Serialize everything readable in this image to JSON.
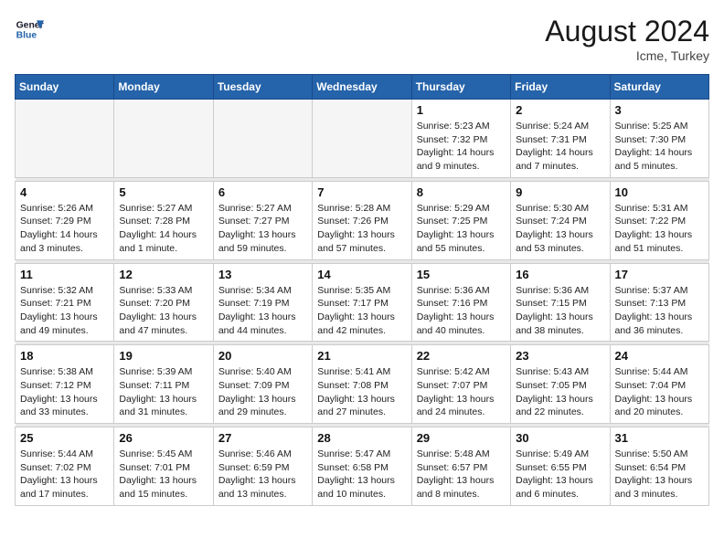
{
  "header": {
    "logo_line1": "General",
    "logo_line2": "Blue",
    "month_year": "August 2024",
    "location": "Icme, Turkey"
  },
  "days_of_week": [
    "Sunday",
    "Monday",
    "Tuesday",
    "Wednesday",
    "Thursday",
    "Friday",
    "Saturday"
  ],
  "weeks": [
    [
      {
        "day": "",
        "info": ""
      },
      {
        "day": "",
        "info": ""
      },
      {
        "day": "",
        "info": ""
      },
      {
        "day": "",
        "info": ""
      },
      {
        "day": "1",
        "info": "Sunrise: 5:23 AM\nSunset: 7:32 PM\nDaylight: 14 hours\nand 9 minutes."
      },
      {
        "day": "2",
        "info": "Sunrise: 5:24 AM\nSunset: 7:31 PM\nDaylight: 14 hours\nand 7 minutes."
      },
      {
        "day": "3",
        "info": "Sunrise: 5:25 AM\nSunset: 7:30 PM\nDaylight: 14 hours\nand 5 minutes."
      }
    ],
    [
      {
        "day": "4",
        "info": "Sunrise: 5:26 AM\nSunset: 7:29 PM\nDaylight: 14 hours\nand 3 minutes."
      },
      {
        "day": "5",
        "info": "Sunrise: 5:27 AM\nSunset: 7:28 PM\nDaylight: 14 hours\nand 1 minute."
      },
      {
        "day": "6",
        "info": "Sunrise: 5:27 AM\nSunset: 7:27 PM\nDaylight: 13 hours\nand 59 minutes."
      },
      {
        "day": "7",
        "info": "Sunrise: 5:28 AM\nSunset: 7:26 PM\nDaylight: 13 hours\nand 57 minutes."
      },
      {
        "day": "8",
        "info": "Sunrise: 5:29 AM\nSunset: 7:25 PM\nDaylight: 13 hours\nand 55 minutes."
      },
      {
        "day": "9",
        "info": "Sunrise: 5:30 AM\nSunset: 7:24 PM\nDaylight: 13 hours\nand 53 minutes."
      },
      {
        "day": "10",
        "info": "Sunrise: 5:31 AM\nSunset: 7:22 PM\nDaylight: 13 hours\nand 51 minutes."
      }
    ],
    [
      {
        "day": "11",
        "info": "Sunrise: 5:32 AM\nSunset: 7:21 PM\nDaylight: 13 hours\nand 49 minutes."
      },
      {
        "day": "12",
        "info": "Sunrise: 5:33 AM\nSunset: 7:20 PM\nDaylight: 13 hours\nand 47 minutes."
      },
      {
        "day": "13",
        "info": "Sunrise: 5:34 AM\nSunset: 7:19 PM\nDaylight: 13 hours\nand 44 minutes."
      },
      {
        "day": "14",
        "info": "Sunrise: 5:35 AM\nSunset: 7:17 PM\nDaylight: 13 hours\nand 42 minutes."
      },
      {
        "day": "15",
        "info": "Sunrise: 5:36 AM\nSunset: 7:16 PM\nDaylight: 13 hours\nand 40 minutes."
      },
      {
        "day": "16",
        "info": "Sunrise: 5:36 AM\nSunset: 7:15 PM\nDaylight: 13 hours\nand 38 minutes."
      },
      {
        "day": "17",
        "info": "Sunrise: 5:37 AM\nSunset: 7:13 PM\nDaylight: 13 hours\nand 36 minutes."
      }
    ],
    [
      {
        "day": "18",
        "info": "Sunrise: 5:38 AM\nSunset: 7:12 PM\nDaylight: 13 hours\nand 33 minutes."
      },
      {
        "day": "19",
        "info": "Sunrise: 5:39 AM\nSunset: 7:11 PM\nDaylight: 13 hours\nand 31 minutes."
      },
      {
        "day": "20",
        "info": "Sunrise: 5:40 AM\nSunset: 7:09 PM\nDaylight: 13 hours\nand 29 minutes."
      },
      {
        "day": "21",
        "info": "Sunrise: 5:41 AM\nSunset: 7:08 PM\nDaylight: 13 hours\nand 27 minutes."
      },
      {
        "day": "22",
        "info": "Sunrise: 5:42 AM\nSunset: 7:07 PM\nDaylight: 13 hours\nand 24 minutes."
      },
      {
        "day": "23",
        "info": "Sunrise: 5:43 AM\nSunset: 7:05 PM\nDaylight: 13 hours\nand 22 minutes."
      },
      {
        "day": "24",
        "info": "Sunrise: 5:44 AM\nSunset: 7:04 PM\nDaylight: 13 hours\nand 20 minutes."
      }
    ],
    [
      {
        "day": "25",
        "info": "Sunrise: 5:44 AM\nSunset: 7:02 PM\nDaylight: 13 hours\nand 17 minutes."
      },
      {
        "day": "26",
        "info": "Sunrise: 5:45 AM\nSunset: 7:01 PM\nDaylight: 13 hours\nand 15 minutes."
      },
      {
        "day": "27",
        "info": "Sunrise: 5:46 AM\nSunset: 6:59 PM\nDaylight: 13 hours\nand 13 minutes."
      },
      {
        "day": "28",
        "info": "Sunrise: 5:47 AM\nSunset: 6:58 PM\nDaylight: 13 hours\nand 10 minutes."
      },
      {
        "day": "29",
        "info": "Sunrise: 5:48 AM\nSunset: 6:57 PM\nDaylight: 13 hours\nand 8 minutes."
      },
      {
        "day": "30",
        "info": "Sunrise: 5:49 AM\nSunset: 6:55 PM\nDaylight: 13 hours\nand 6 minutes."
      },
      {
        "day": "31",
        "info": "Sunrise: 5:50 AM\nSunset: 6:54 PM\nDaylight: 13 hours\nand 3 minutes."
      }
    ]
  ]
}
